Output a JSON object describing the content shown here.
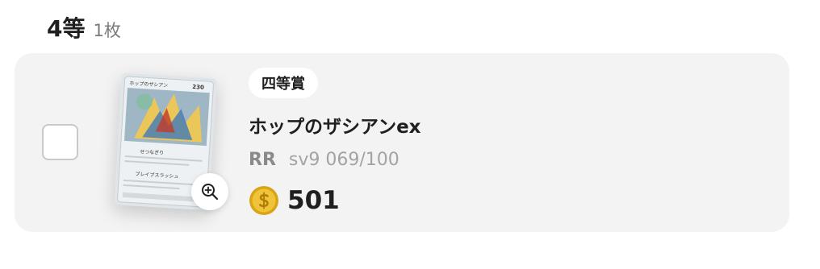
{
  "section": {
    "title": "4等",
    "count": "1枚"
  },
  "card": {
    "prize_label": "四等賞",
    "name": "ホップのザシアンex",
    "rarity": "RR",
    "set_code": "sv9 069/100",
    "price": "501",
    "thumbnail_text": {
      "name": "ホップのザシアン",
      "hp": "230",
      "ability": "せつなぎり",
      "attack": "ブレイブスラッシュ"
    }
  },
  "icons": {
    "zoom": "zoom-in-icon",
    "coin": "coin-icon"
  },
  "colors": {
    "card_bg": "#f3f3f3",
    "coin_gold": "#e2b320",
    "muted_text": "#8a8a8a"
  }
}
